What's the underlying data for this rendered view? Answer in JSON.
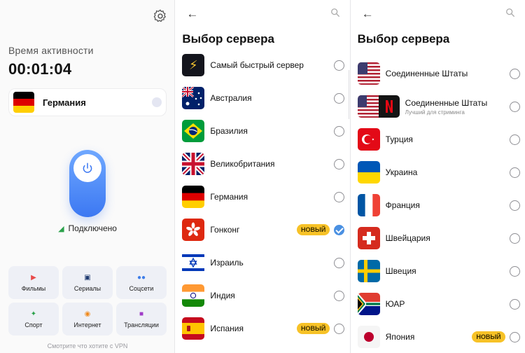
{
  "home": {
    "active_label": "Время активности",
    "timer": "00:01:04",
    "selected_country": "Германия",
    "status": "Подключено",
    "categories": [
      {
        "label": "Фильмы",
        "icon": "video-icon",
        "color": "#e84a4a"
      },
      {
        "label": "Сериалы",
        "icon": "tv-icon",
        "color": "#1f3a70"
      },
      {
        "label": "Соцсети",
        "icon": "people-icon",
        "color": "#3f7ee8"
      },
      {
        "label": "Спорт",
        "icon": "running-icon",
        "color": "#2aa14a"
      },
      {
        "label": "Интернет",
        "icon": "globe-icon",
        "color": "#f08a1d"
      },
      {
        "label": "Трансляции",
        "icon": "broadcast-icon",
        "color": "#a03cc8"
      }
    ],
    "footer": "Смотрите что хотите с VPN"
  },
  "server_list": {
    "title": "Выбор сервера",
    "badge_new": "НОВЫЙ",
    "items_left": [
      {
        "name": "Самый быстрый сервер",
        "flag": "fastest",
        "selected": false,
        "new": false
      },
      {
        "name": "Австралия",
        "flag": "au",
        "selected": false,
        "new": false
      },
      {
        "name": "Бразилия",
        "flag": "br",
        "selected": false,
        "new": false
      },
      {
        "name": "Великобритания",
        "flag": "gb",
        "selected": false,
        "new": false
      },
      {
        "name": "Германия",
        "flag": "de",
        "selected": false,
        "new": false
      },
      {
        "name": "Гонконг",
        "flag": "hk",
        "selected": true,
        "new": true
      },
      {
        "name": "Израиль",
        "flag": "il",
        "selected": false,
        "new": false
      },
      {
        "name": "Индия",
        "flag": "in",
        "selected": false,
        "new": false
      },
      {
        "name": "Испания",
        "flag": "es",
        "selected": false,
        "new": true
      }
    ],
    "items_right": [
      {
        "name": "Соединенные Штаты",
        "flag": "us",
        "selected": false,
        "new": false
      },
      {
        "name": "Соединенные Штаты",
        "sub": "Лучший для стриминга",
        "flag": "us-n",
        "selected": false,
        "new": false
      },
      {
        "name": "Турция",
        "flag": "tr",
        "selected": false,
        "new": false
      },
      {
        "name": "Украина",
        "flag": "ua",
        "selected": false,
        "new": false
      },
      {
        "name": "Франция",
        "flag": "fr",
        "selected": false,
        "new": false
      },
      {
        "name": "Швейцария",
        "flag": "ch",
        "selected": false,
        "new": false
      },
      {
        "name": "Швеция",
        "flag": "se",
        "selected": false,
        "new": false
      },
      {
        "name": "ЮАР",
        "flag": "za",
        "selected": false,
        "new": false
      },
      {
        "name": "Япония",
        "flag": "jp",
        "selected": false,
        "new": true
      }
    ]
  }
}
